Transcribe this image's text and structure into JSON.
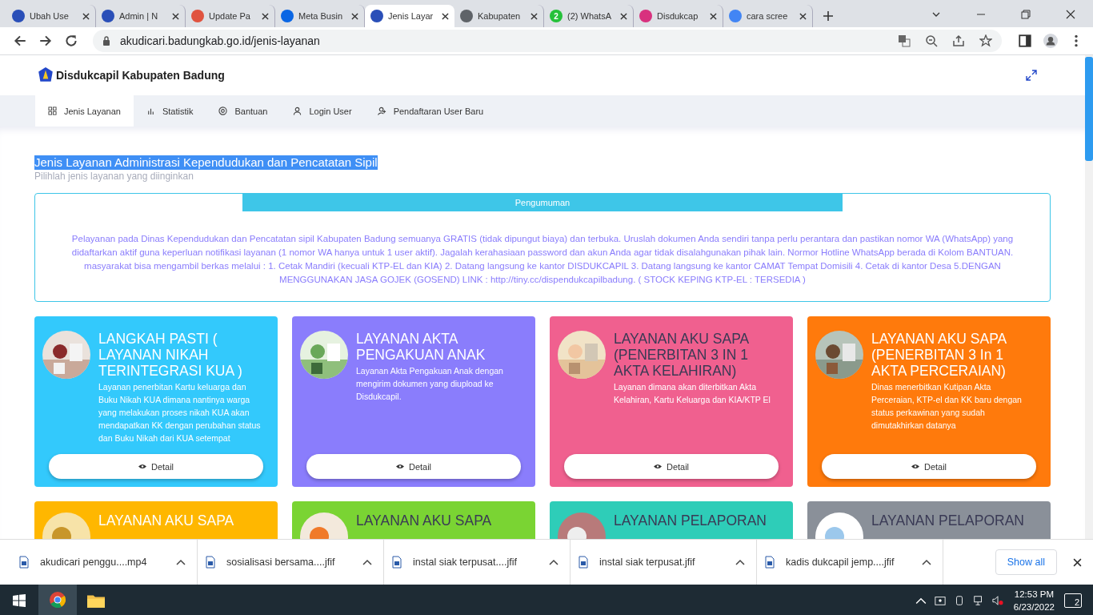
{
  "browser": {
    "tabs": [
      {
        "title": "Ubah Use",
        "selected": false,
        "color": "#2a4fb8"
      },
      {
        "title": "Admin | N",
        "selected": false,
        "color": "#2a4fb8"
      },
      {
        "title": "Update Pa",
        "selected": false,
        "color": "#e0533f"
      },
      {
        "title": "Meta Busin",
        "selected": false,
        "color": "#0a66e4"
      },
      {
        "title": "Jenis Layar",
        "selected": true,
        "color": "#2a4fb8"
      },
      {
        "title": "Kabupaten",
        "selected": false,
        "color": "#5f6368"
      },
      {
        "title": "(2) WhatsA",
        "selected": false,
        "color": "#25c13a",
        "badge": "2"
      },
      {
        "title": "Disdukcap",
        "selected": false,
        "color": "#d8317e"
      },
      {
        "title": "cara scree",
        "selected": false,
        "color": "#4285f4"
      }
    ],
    "address": "akudicari.badungkab.go.id/jenis-layanan"
  },
  "site": {
    "brand": "Disdukcapil Kabupaten Badung",
    "nav": [
      {
        "label": "Jenis Layanan",
        "selected": true
      },
      {
        "label": "Statistik",
        "selected": false
      },
      {
        "label": "Bantuan",
        "selected": false
      },
      {
        "label": "Login User",
        "selected": false
      },
      {
        "label": "Pendaftaran User Baru",
        "selected": false
      }
    ],
    "heading": {
      "text": "Jenis Layanan Administrasi Kependudukan dan Pencatatan Sipil",
      "selected": true
    },
    "subheading": "Pilihlah jenis layanan yang diinginkan",
    "announcement": {
      "title": "Pengumuman",
      "text": "Pelayanan pada Dinas Kependudukan dan Pencatatan sipil Kabupaten Badung semuanya GRATIS (tidak dipungut biaya) dan terbuka. Uruslah dokumen Anda sendiri tanpa perlu perantara dan pastikan nomor WA (WhatsApp) yang didaftarkan aktif guna keperluan notifikasi layanan (1 nomor WA hanya untuk 1 user aktif). Jagalah kerahasiaan password dan akun Anda agar tidak disalahgunakan pihak lain. Normor Hotline WhatsApp berada di Kolom BANTUAN. masyarakat bisa mengambil berkas melalui : 1. Cetak Mandiri (kecuali KTP-EL dan KIA) 2. Datang langsung ke kantor DISDUKCAPIL 3. Datang langsung ke kantor CAMAT Tempat Domisili 4. Cetak di kantor Desa 5.DENGAN MENGGUNAKAN JASA GOJEK (GOSEND) LINK : http://tiny.cc/dispendukcapilbadung. ( STOCK KEPING KTP-EL : TERSEDIA )"
    },
    "cards": [
      {
        "title": "LANGKAH PASTI ( LAYANAN NIKAH TERINTEGRASI KUA )",
        "description": "Layanan penerbitan Kartu keluarga dan Buku Nikah KUA dimana nantinya warga yang melakukan proses nikah KUA akan mendapatkan KK dengan perubahan status dan Buku Nikah dari KUA setempat",
        "button": "Detail",
        "color": "#33c9fc",
        "dark_title": false
      },
      {
        "title": "LAYANAN AKTA PENGAKUAN ANAK",
        "description": "Layanan Akta Pengakuan Anak dengan mengirim dokumen yang diupload ke Disdukcapil.",
        "button": "Detail",
        "color": "#8a7dfc",
        "dark_title": false
      },
      {
        "title": "LAYANAN AKU SAPA (PENERBITAN 3 IN 1 AKTA KELAHIRAN)",
        "description": "Layanan dimana akan diterbitkan Akta Kelahiran, Kartu Keluarga dan KIA/KTP El",
        "button": "Detail",
        "color": "#f0608f",
        "dark_title": true
      },
      {
        "title": "LAYANAN AKU SAPA (PENERBITAN 3 In 1 AKTA PERCERAIAN)",
        "description": "Dinas menerbitkan Kutipan Akta Perceraian, KTP-el dan KK baru dengan status perkawinan yang sudah dimutakhirkan datanya",
        "button": "Detail",
        "color": "#ff7a0c",
        "dark_title": false
      }
    ],
    "cards_partial": [
      {
        "title": "LAYANAN AKU SAPA",
        "color": "#ffb700",
        "dark_title": false
      },
      {
        "title": "LAYANAN AKU SAPA",
        "color": "#7ad433",
        "dark_title": true
      },
      {
        "title": "LAYANAN PELAPORAN",
        "color": "#2ecdb8",
        "dark_title": true
      },
      {
        "title": "LAYANAN PELAPORAN",
        "color": "#8a9099",
        "dark_title": true
      }
    ]
  },
  "downloads": {
    "items": [
      {
        "name": "akudicari penggu....mp4"
      },
      {
        "name": "sosialisasi bersama....jfif"
      },
      {
        "name": "instal siak terpusat....jfif"
      },
      {
        "name": "instal siak terpusat.jfif"
      },
      {
        "name": "kadis dukcapil jemp....jfif"
      }
    ],
    "show_all": "Show all"
  },
  "taskbar": {
    "time": "12:53 PM",
    "date": "6/23/2022",
    "notifications": "2"
  }
}
